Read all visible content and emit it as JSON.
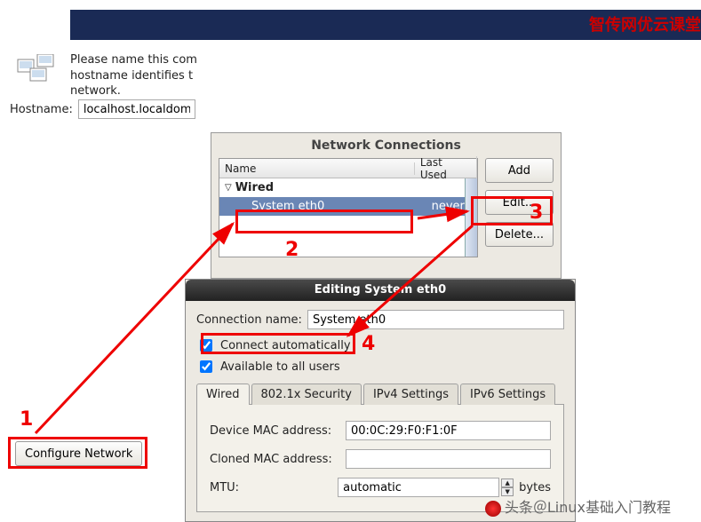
{
  "watermarks": {
    "top": "智传网优云课堂",
    "bottom": "头条＠Linux基础入门教程"
  },
  "narrative": "Please name this com\nhostname identifies t\nnetwork.",
  "hostname": {
    "label": "Hostname:",
    "value": "localhost.localdomai"
  },
  "nc": {
    "title": "Network Connections",
    "cols": {
      "name": "Name",
      "last": "Last Used"
    },
    "group": "Wired",
    "row": {
      "name": "System eth0",
      "last": "never"
    },
    "buttons": {
      "add": "Add",
      "edit": "Edit...",
      "del": "Delete..."
    }
  },
  "dlg": {
    "title": "Editing System eth0",
    "conn_label": "Connection name:",
    "conn_value": "System eth0",
    "chk_auto": "Connect automatically",
    "chk_users": "Available to all users",
    "tabs": {
      "wired": "Wired",
      "sec": "802.1x Security",
      "v4": "IPv4 Settings",
      "v6": "IPv6 Settings"
    },
    "form": {
      "mac_label": "Device MAC address:",
      "mac_value": "00:0C:29:F0:F1:0F",
      "clone_label": "Cloned MAC address:",
      "clone_value": "",
      "mtu_label": "MTU:",
      "mtu_value": "automatic",
      "mtu_unit": "bytes"
    }
  },
  "cfg_btn": "Configure Network",
  "annot": {
    "n1": "1",
    "n2": "2",
    "n3": "3",
    "n4": "4"
  },
  "tri": "▽"
}
